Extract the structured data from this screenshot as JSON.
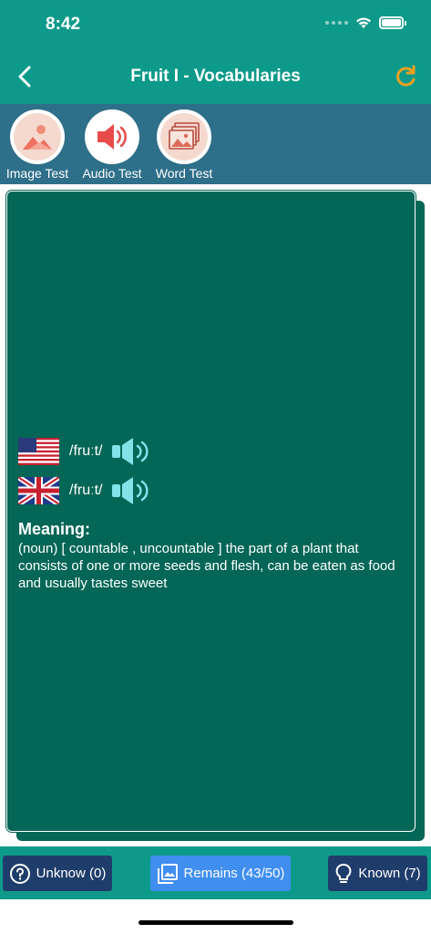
{
  "status_bar": {
    "time": "8:42"
  },
  "nav": {
    "title": "Fruit I - Vocabularies",
    "back_icon": "chevron-left-icon",
    "refresh_icon": "refresh-icon"
  },
  "tests": [
    {
      "label": "Image Test",
      "icon": "image-test-icon"
    },
    {
      "label": "Audio Test",
      "icon": "speaker-icon"
    },
    {
      "label": "Word Test",
      "icon": "stacked-images-icon"
    }
  ],
  "card": {
    "pronunciations": [
      {
        "flag": "us-flag-icon",
        "ipa": "/fruːt/"
      },
      {
        "flag": "uk-flag-icon",
        "ipa": "/fruːt/"
      }
    ],
    "meaning_title": "Meaning:",
    "meaning_text": "(noun) [ countable ,  uncountable ]  the part of a plant that consists of one or more seeds and flesh, can be eaten as food and usually tastes sweet"
  },
  "bottom": {
    "unknown_label": "Unknow (0)",
    "remains_label": "Remains (43/50)",
    "known_label": "Known (7)"
  },
  "colors": {
    "header": "#0e9a8a",
    "test_bar": "#2e6f8a",
    "card": "#046656",
    "dark_button": "#1f3d6b",
    "blue_button": "#3f8ef0",
    "accent": "#f0a020"
  }
}
